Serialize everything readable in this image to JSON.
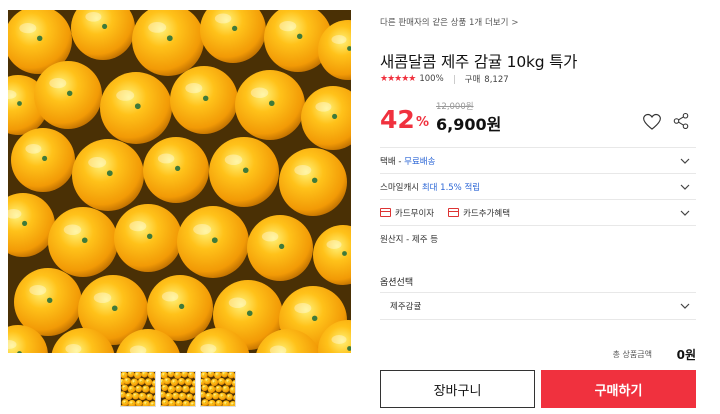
{
  "other_seller_link": "다른 판매자의 같은 상품 1개 더보기",
  "product": {
    "title": "새콤달콤 제주 감귤 10kg 특가",
    "rating_stars": "★★★★★",
    "rating_percent": "100%",
    "buy_label": "구매",
    "buy_count": "8,127"
  },
  "price": {
    "discount": "42",
    "discount_unit": "%",
    "original": "12,000원",
    "sale": "6,900원"
  },
  "icons": {
    "heart": "heart-icon",
    "share": "share-icon",
    "chevron": "chevron-down-icon",
    "card": "card-icon"
  },
  "info": {
    "delivery_label": "택배 - ",
    "delivery_value": "무료배송",
    "smile_label": "스마일캐시 ",
    "smile_value": "최대 1.5% 적립",
    "card_free": "카드무이자",
    "card_extra": "카드추가혜택",
    "origin": "원산지 - 제주 등"
  },
  "option": {
    "title": "옵션선택",
    "selected": "제주감귤"
  },
  "total": {
    "label": "총 상품금액",
    "value": "0원"
  },
  "buttons": {
    "cart": "장바구니",
    "buy": "구매하기"
  },
  "colors": {
    "accent": "#f0313e",
    "link_blue": "#2d67d6"
  }
}
